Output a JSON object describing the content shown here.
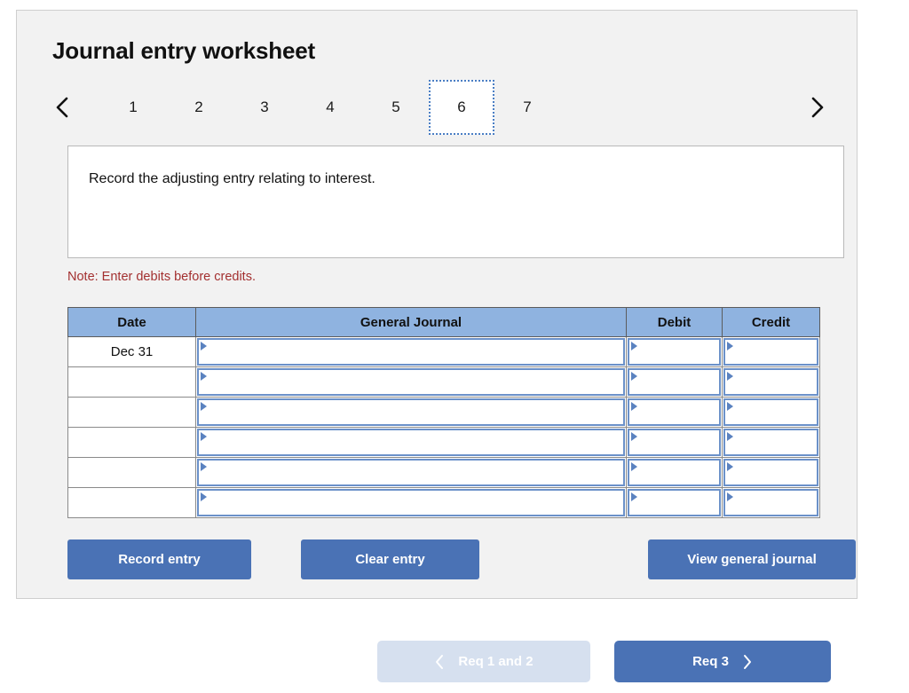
{
  "panel": {
    "title": "Journal entry worksheet"
  },
  "tabs": {
    "prev_icon": "chevron-left-icon",
    "next_icon": "chevron-right-icon",
    "items": [
      {
        "label": "1",
        "selected": false
      },
      {
        "label": "2",
        "selected": false
      },
      {
        "label": "3",
        "selected": false
      },
      {
        "label": "4",
        "selected": false
      },
      {
        "label": "5",
        "selected": false
      },
      {
        "label": "6",
        "selected": true
      },
      {
        "label": "7",
        "selected": false
      }
    ],
    "selected": "6"
  },
  "prompt": {
    "text": "Record the adjusting entry relating to interest."
  },
  "note": {
    "text": "Note: Enter debits before credits."
  },
  "table": {
    "headers": [
      "Date",
      "General Journal",
      "Debit",
      "Credit"
    ],
    "rows": [
      {
        "date": "Dec 31",
        "general_journal": "",
        "debit": "",
        "credit": ""
      },
      {
        "date": "",
        "general_journal": "",
        "debit": "",
        "credit": ""
      },
      {
        "date": "",
        "general_journal": "",
        "debit": "",
        "credit": ""
      },
      {
        "date": "",
        "general_journal": "",
        "debit": "",
        "credit": ""
      },
      {
        "date": "",
        "general_journal": "",
        "debit": "",
        "credit": ""
      },
      {
        "date": "",
        "general_journal": "",
        "debit": "",
        "credit": ""
      }
    ]
  },
  "actions": {
    "record_label": "Record entry",
    "clear_label": "Clear entry",
    "view_label": "View general journal"
  },
  "requirement_nav": {
    "prev_label": "Req 1 and 2",
    "prev_icon": "chevron-left-icon",
    "prev_disabled": true,
    "next_label": "Req 3",
    "next_icon": "chevron-right-icon"
  },
  "colors": {
    "panel_bg": "#f2f2f2",
    "header_blue": "#8fb3e0",
    "button_blue": "#4a72b5",
    "disabled_blue": "#d6e0ef",
    "note_red": "#a33030",
    "input_border_blue": "#6b91c9"
  }
}
